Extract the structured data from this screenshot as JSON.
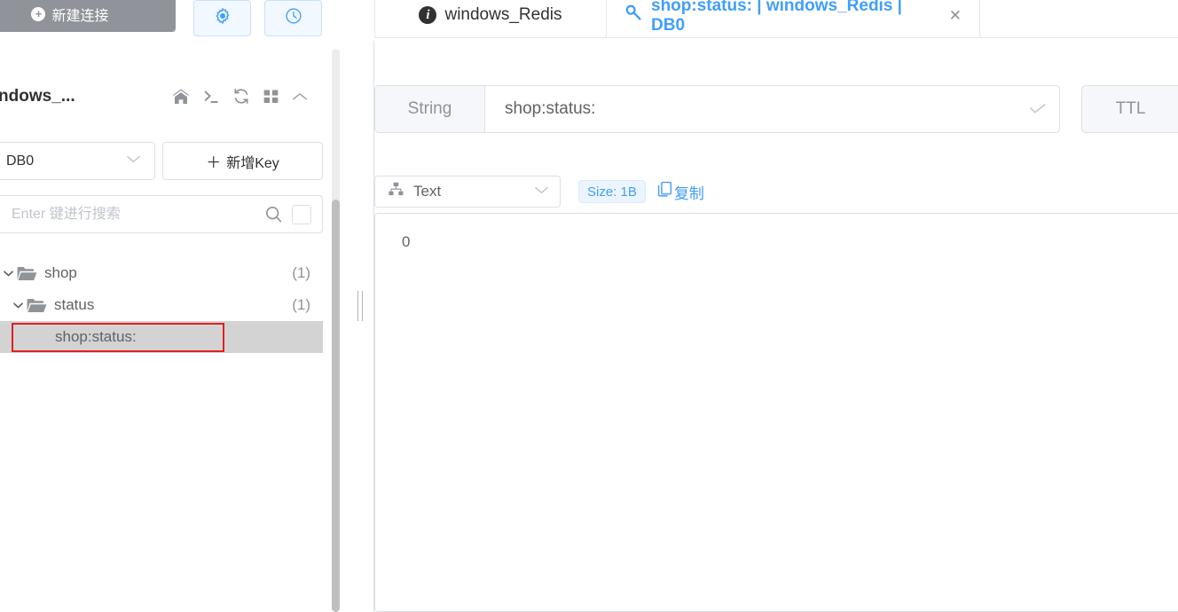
{
  "sidebar": {
    "new_connection_label": "新建连接",
    "new_connection_icon": "plus-circle-icon",
    "settings_icon": "gear-icon",
    "history_icon": "clock-icon",
    "connection_name": "windows_...",
    "toolbar_icons": [
      "home-icon",
      "terminal-icon",
      "refresh-icon",
      "grid-icon",
      "chevron-up-icon"
    ],
    "db_selected": "DB0",
    "db_caret_icon": "chevron-down-icon",
    "add_key_label": "新增Key",
    "add_key_plus": "＋",
    "search_placeholder": "Enter 键进行搜索",
    "search_value": "",
    "search_icon": "search-icon",
    "search_checkbox_icon": "checkbox-icon",
    "tree": [
      {
        "label": "shop",
        "count": "(1)",
        "type": "folder",
        "depth": 0,
        "expanded": true,
        "selected": false,
        "arrow": "chevron-down-icon"
      },
      {
        "label": "status",
        "count": "(1)",
        "type": "folder",
        "depth": 1,
        "expanded": true,
        "selected": false,
        "arrow": "chevron-down-icon"
      },
      {
        "label": "shop:status:",
        "count": "",
        "type": "key",
        "depth": 2,
        "expanded": false,
        "selected": true,
        "arrow": ""
      }
    ],
    "annotation_color": "#e02020"
  },
  "splitter": {
    "name": "panel-splitter"
  },
  "tabs": [
    {
      "label": "windows_Redis",
      "icon": "info-icon",
      "active": false,
      "closable": false
    },
    {
      "label": "shop:status: | windows_Redis | DB0",
      "icon": "key-icon",
      "active": true,
      "closable": true,
      "close_icon": "close-icon"
    }
  ],
  "key_editor": {
    "type_label": "String",
    "key_name": "shop:status:",
    "key_name_placeholder": "",
    "save_icon": "check-icon",
    "ttl_label": "TTL",
    "ttl_value": ""
  },
  "value_panel": {
    "format_selected": "Text",
    "format_icon": "hierarchy-icon",
    "format_caret_icon": "chevron-down-icon",
    "size_badge": "Size: 1B",
    "copy_label": "复制",
    "copy_icon": "copy-icon",
    "value": "0"
  },
  "colors": {
    "accent": "#409eff",
    "accent_light_bg": "#ecf5ff",
    "border": "#dcdfe6",
    "text_primary": "#303133",
    "text_regular": "#606266",
    "text_secondary": "#909399",
    "placeholder": "#c0c4cc",
    "selected_row_bg": "#d3d3d3",
    "annotation_red": "#e02020",
    "button_gray": "#909399"
  }
}
